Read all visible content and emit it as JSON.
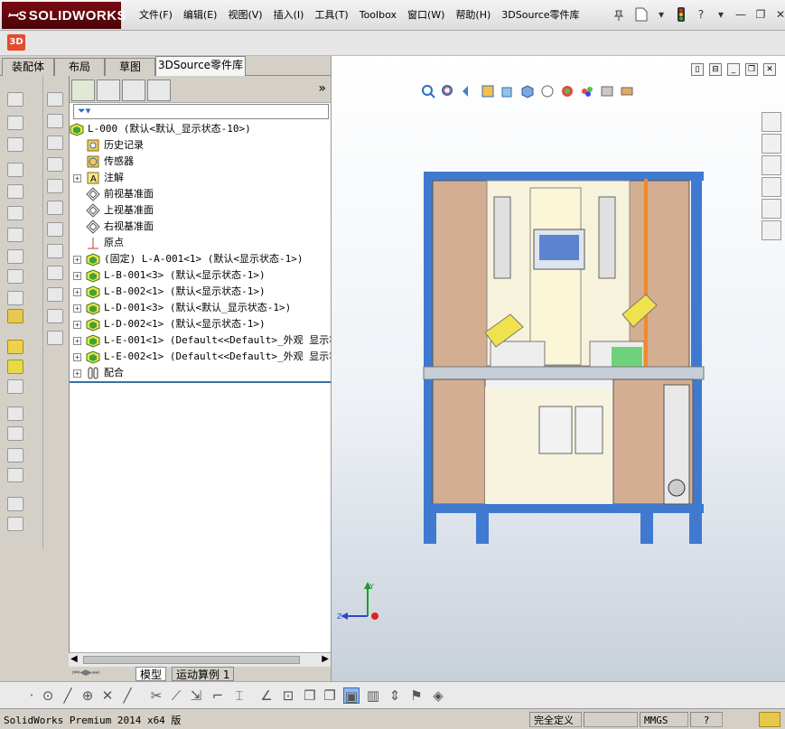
{
  "app": {
    "name": "SOLIDWORKS"
  },
  "menu": [
    "文件(F)",
    "编辑(E)",
    "视图(V)",
    "插入(I)",
    "工具(T)",
    "Toolbox",
    "窗口(W)",
    "帮助(H)",
    "3DSource零件库"
  ],
  "tabs": [
    "装配体",
    "布局",
    "草图",
    "3DSource零件库"
  ],
  "tree": {
    "root": "L-000  (默认<默认_显示状态-10>)",
    "items": [
      {
        "label": "历史记录",
        "icon": "history-icon",
        "expandable": false
      },
      {
        "label": "传感器",
        "icon": "sensor-icon",
        "expandable": false
      },
      {
        "label": "注解",
        "icon": "annotation-icon",
        "expandable": true
      },
      {
        "label": "前视基准面",
        "icon": "plane-icon",
        "expandable": false
      },
      {
        "label": "上视基准面",
        "icon": "plane-icon",
        "expandable": false
      },
      {
        "label": "右视基准面",
        "icon": "plane-icon",
        "expandable": false
      },
      {
        "label": "原点",
        "icon": "origin-icon",
        "expandable": false
      },
      {
        "label": "(固定) L-A-001<1> (默认<显示状态-1>)",
        "icon": "assembly-icon",
        "expandable": true
      },
      {
        "label": "L-B-001<3> (默认<显示状态-1>)",
        "icon": "assembly-icon",
        "expandable": true
      },
      {
        "label": "L-B-002<1> (默认<显示状态-1>)",
        "icon": "assembly-icon",
        "expandable": true
      },
      {
        "label": "L-D-001<3> (默认<默认_显示状态-1>)",
        "icon": "assembly-icon",
        "expandable": true
      },
      {
        "label": "L-D-002<1> (默认<显示状态-1>)",
        "icon": "assembly-icon",
        "expandable": true
      },
      {
        "label": "L-E-001<1> (Default<<Default>_外观 显示状态",
        "icon": "assembly-icon",
        "expandable": true
      },
      {
        "label": "L-E-002<1> (Default<<Default>_外观 显示状态",
        "icon": "assembly-icon",
        "expandable": true
      },
      {
        "label": "配合",
        "icon": "mates-icon",
        "expandable": true
      }
    ]
  },
  "bottom_tabs": [
    "模型",
    "运动算例 1"
  ],
  "triad": {
    "x": "X",
    "y": "Y",
    "z": "Z"
  },
  "status": {
    "version": "SolidWorks Premium 2014 x64 版",
    "definition": "完全定义",
    "units": "MMGS"
  },
  "colors": {
    "frame": "#4a80c8",
    "panel": "#cfa88a",
    "logo_bg": "#6b0a10"
  }
}
